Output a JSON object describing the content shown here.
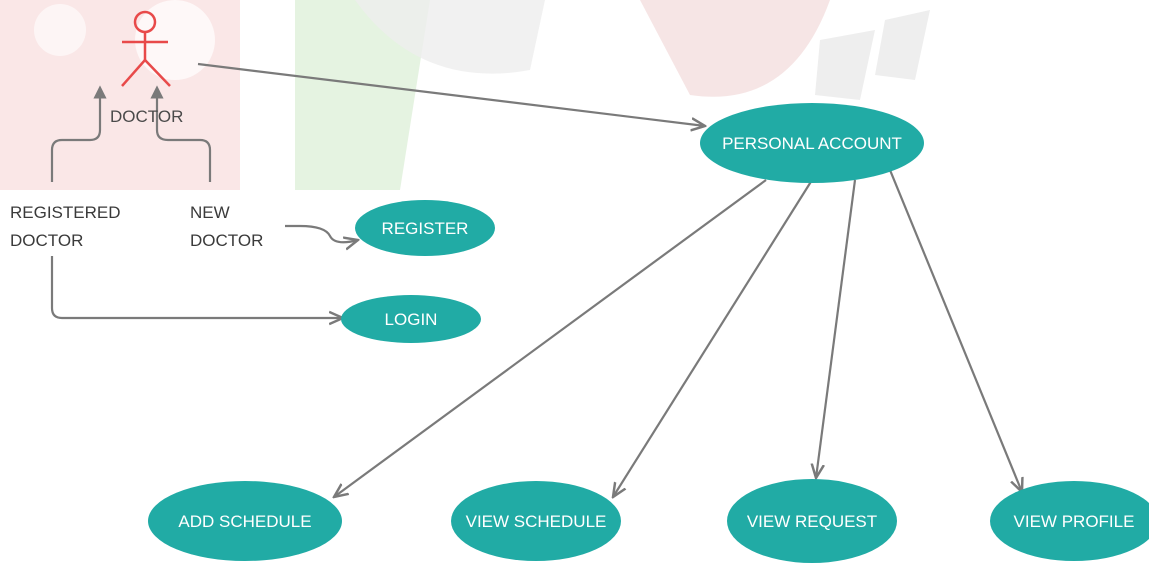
{
  "diagram": {
    "actor": {
      "label": "DOCTOR"
    },
    "labels": {
      "registered_line1": "REGISTERED",
      "registered_line2": "DOCTOR",
      "new_line1": "NEW",
      "new_line2": "DOCTOR"
    },
    "use_cases": {
      "personal_account": "PERSONAL ACCOUNT",
      "register": "REGISTER",
      "login": "LOGIN",
      "add_schedule": "ADD SCHEDULE",
      "view_schedule": "VIEW SCHEDULE",
      "view_request": "VIEW REQUEST",
      "view_profile": "VIEW PROFILE"
    },
    "colors": {
      "use_case_fill": "#21aba5",
      "actor_stroke": "#e84a4a",
      "connector": "#7a7a7a",
      "watermark_red": "#f6c9c9",
      "watermark_green": "#d7ecd2",
      "watermark_gray": "#ececec"
    }
  }
}
